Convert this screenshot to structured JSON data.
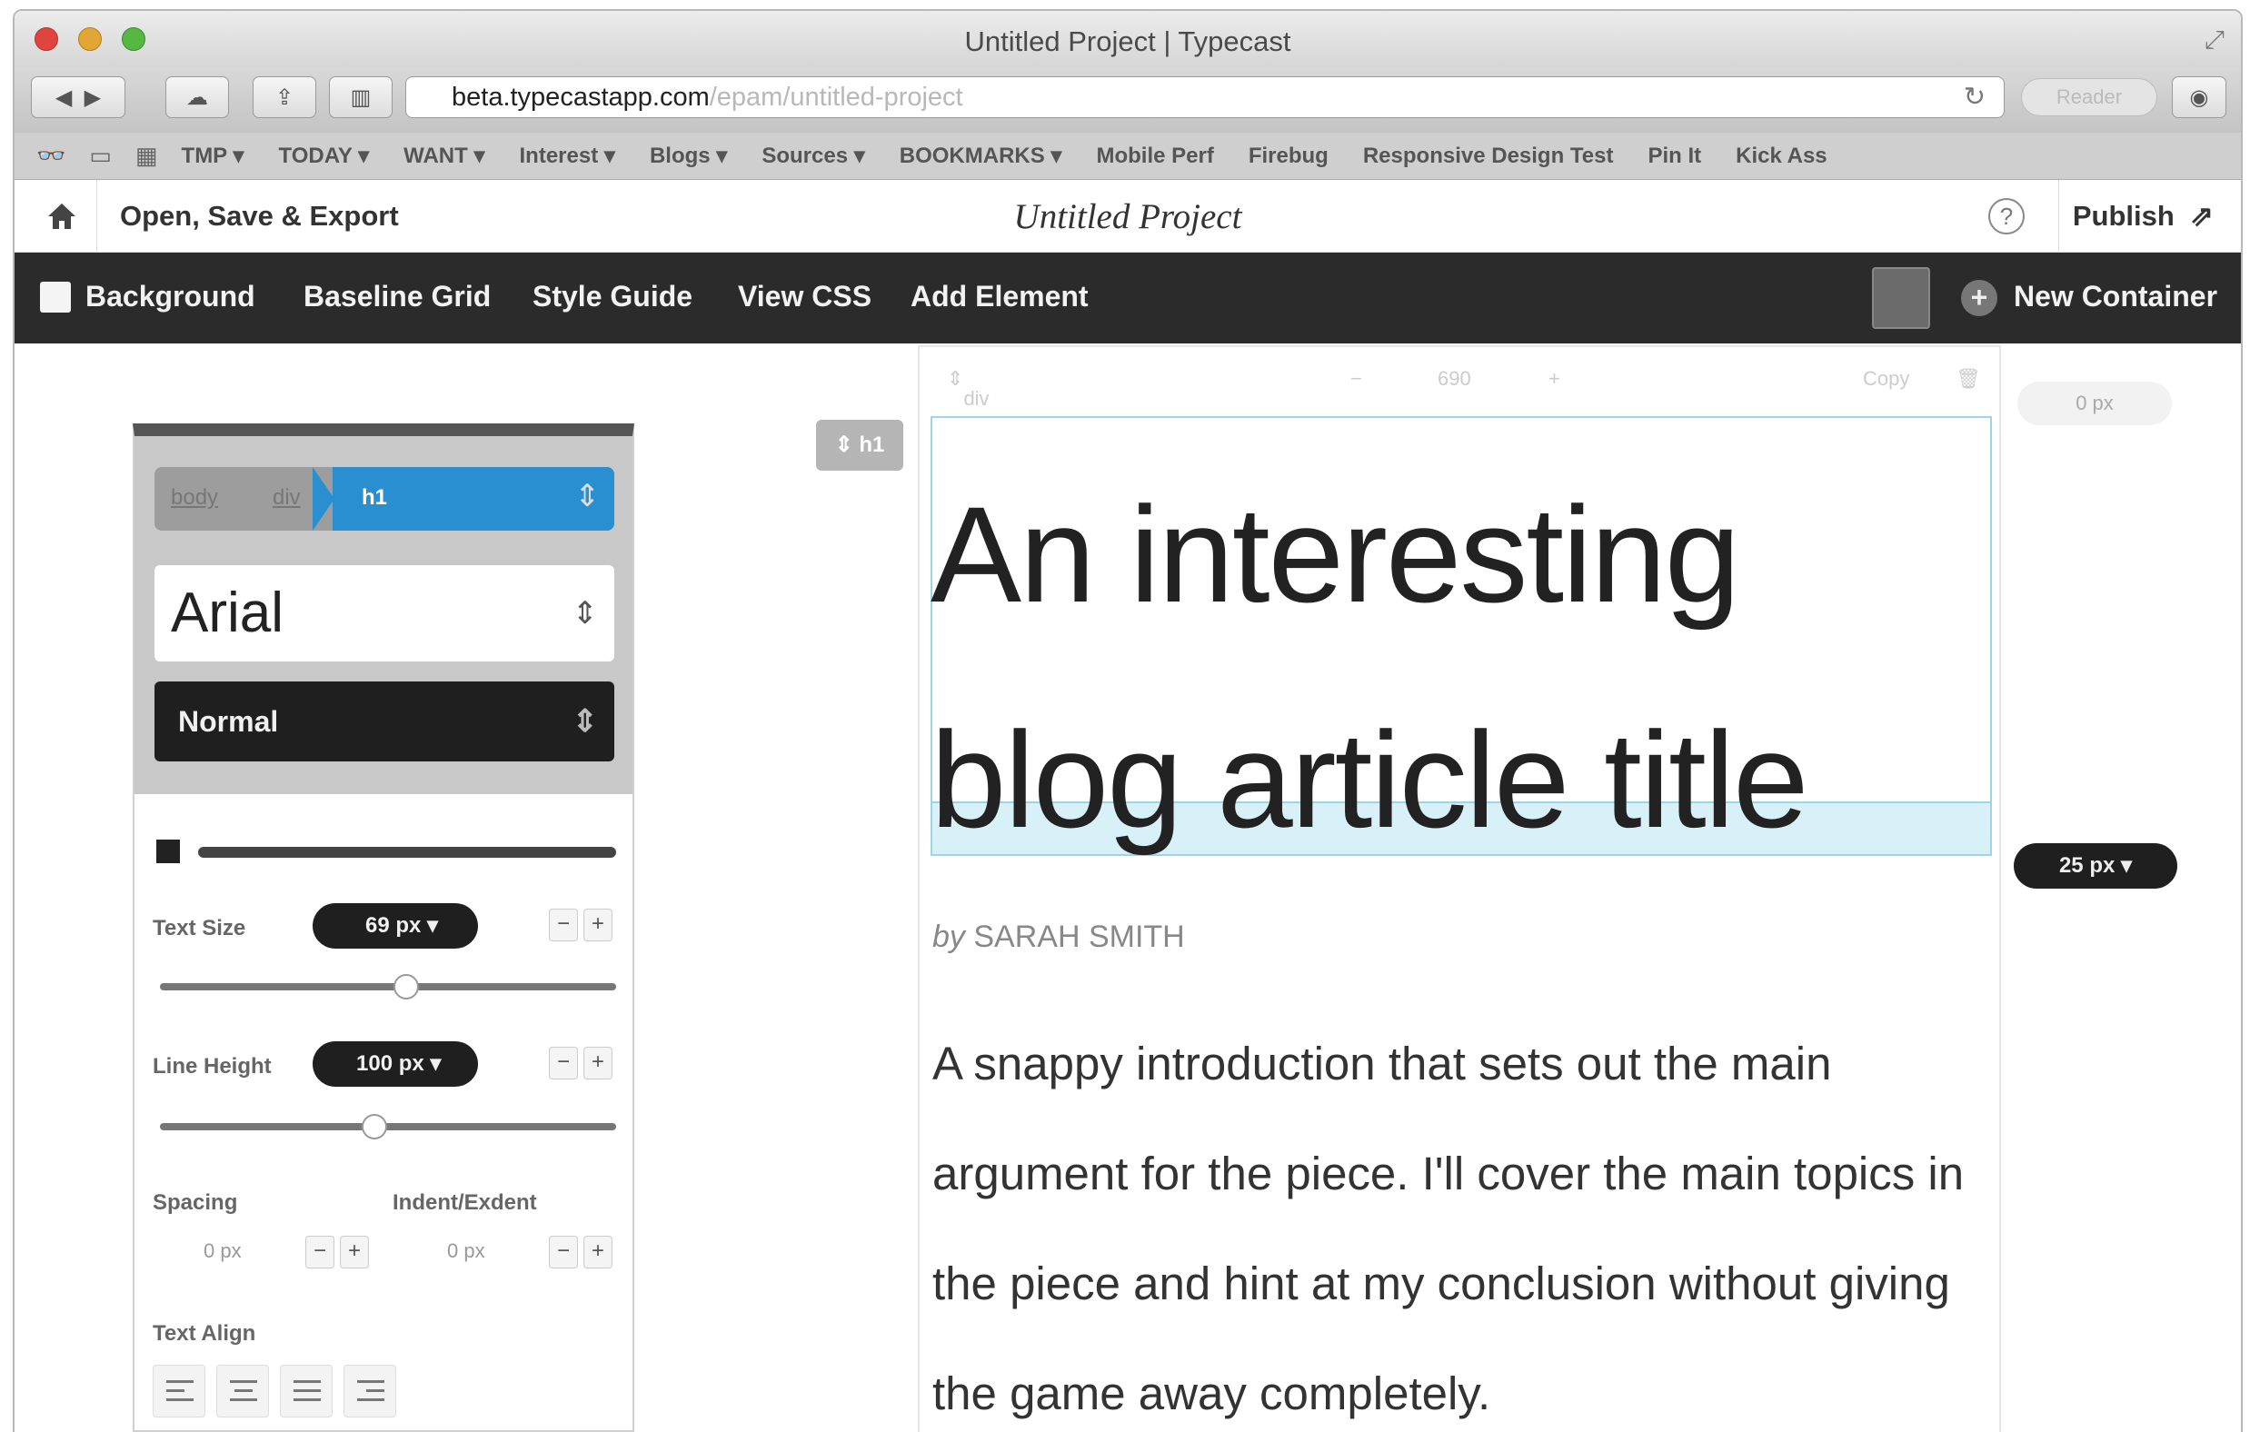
{
  "window": {
    "title": "Untitled Project | Typecast"
  },
  "toolbar": {
    "url_host": "beta.typecastapp.com",
    "url_path": "/epam/untitled-project",
    "reader_label": "Reader"
  },
  "bookmarks": [
    {
      "label": "TMP ▾"
    },
    {
      "label": "TODAY ▾"
    },
    {
      "label": "WANT ▾"
    },
    {
      "label": "Interest ▾"
    },
    {
      "label": "Blogs ▾"
    },
    {
      "label": "Sources ▾"
    },
    {
      "label": "BOOKMARKS ▾"
    },
    {
      "label": "Mobile Perf"
    },
    {
      "label": "Firebug"
    },
    {
      "label": "Responsive Design Test"
    },
    {
      "label": "Pin It"
    },
    {
      "label": "Kick Ass"
    }
  ],
  "app_header": {
    "open_save": "Open, Save & Export",
    "project_title": "Untitled Project",
    "help": "?",
    "publish": "Publish"
  },
  "darkbar": {
    "background": "Background",
    "baseline_grid": "Baseline Grid",
    "style_guide": "Style Guide",
    "view_css": "View CSS",
    "add_element": "Add Element",
    "new_container": "New Container"
  },
  "inspector": {
    "crumbs": [
      "body",
      "div",
      "h1"
    ],
    "font": "Arial",
    "weight": "Normal",
    "text_size_label": "Text Size",
    "text_size_value": "69 px",
    "text_size_fraction": 0.54,
    "line_height_label": "Line Height",
    "line_height_value": "100 px",
    "line_height_fraction": 0.47,
    "spacing_label": "Spacing",
    "spacing_value": "0 px",
    "indent_label": "Indent/Exdent",
    "indent_value": "0 px",
    "text_align_label": "Text Align"
  },
  "canvas": {
    "element_tag": "h1",
    "container_tag": "div",
    "container_width": "690",
    "copy_label": "Copy",
    "headline": "An interesting blog article title",
    "byline_prefix": "by",
    "byline_author": "SARAH SMITH",
    "intro": "A snappy introduction that sets out the main argument for the piece. I'll cover the main topics in the piece and hint at my conclusion without giving the game away completely.",
    "right_top_value": "0 px",
    "margin_value": "25 px"
  },
  "colors": {
    "accent": "#2a8fd0",
    "dark_bar": "#2b2b2b",
    "highlight": "#d8f0f8"
  }
}
